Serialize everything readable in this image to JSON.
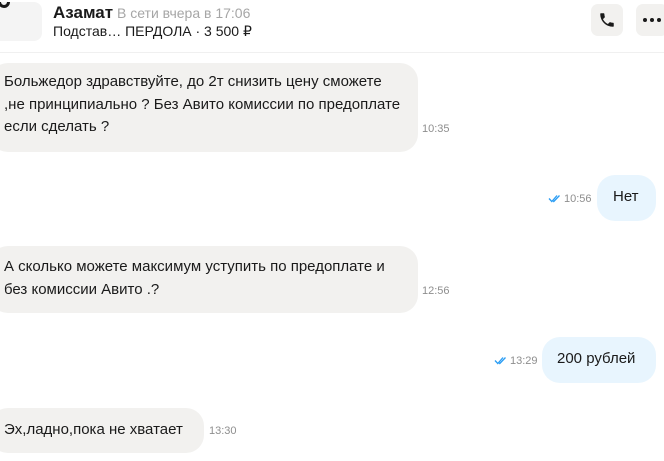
{
  "header": {
    "name": "Азамат",
    "status": "В сети вчера в 17:06",
    "subtitle": "Подстав… ПЕРДОЛА · 3 500 ₽",
    "call_icon": "phone-icon",
    "more_icon": "more-dots-icon"
  },
  "messages": [
    {
      "direction": "in",
      "text": "Больжедор здравствуйте, до 2т снизить цену сможете ,не принципиально ?  Без Авито комиссии по предоплате если сделать ?",
      "time": "10:35"
    },
    {
      "direction": "out",
      "text": "Нет",
      "time": "10:56",
      "read": true
    },
    {
      "direction": "in",
      "text": "А сколько можете максимум уступить по предоплате и без комиссии Авито .?",
      "time": "12:56"
    },
    {
      "direction": "out",
      "text": "200 рублей",
      "time": "13:29",
      "read": true
    },
    {
      "direction": "in",
      "text": "Эх,ладно,пока не хватает",
      "time": "13:30"
    }
  ],
  "colors": {
    "incoming_bubble": "#f2f1ef",
    "outgoing_bubble": "#e8f5fe",
    "read_ticks": "#2a9df4",
    "muted_text": "#8e8e8e"
  }
}
